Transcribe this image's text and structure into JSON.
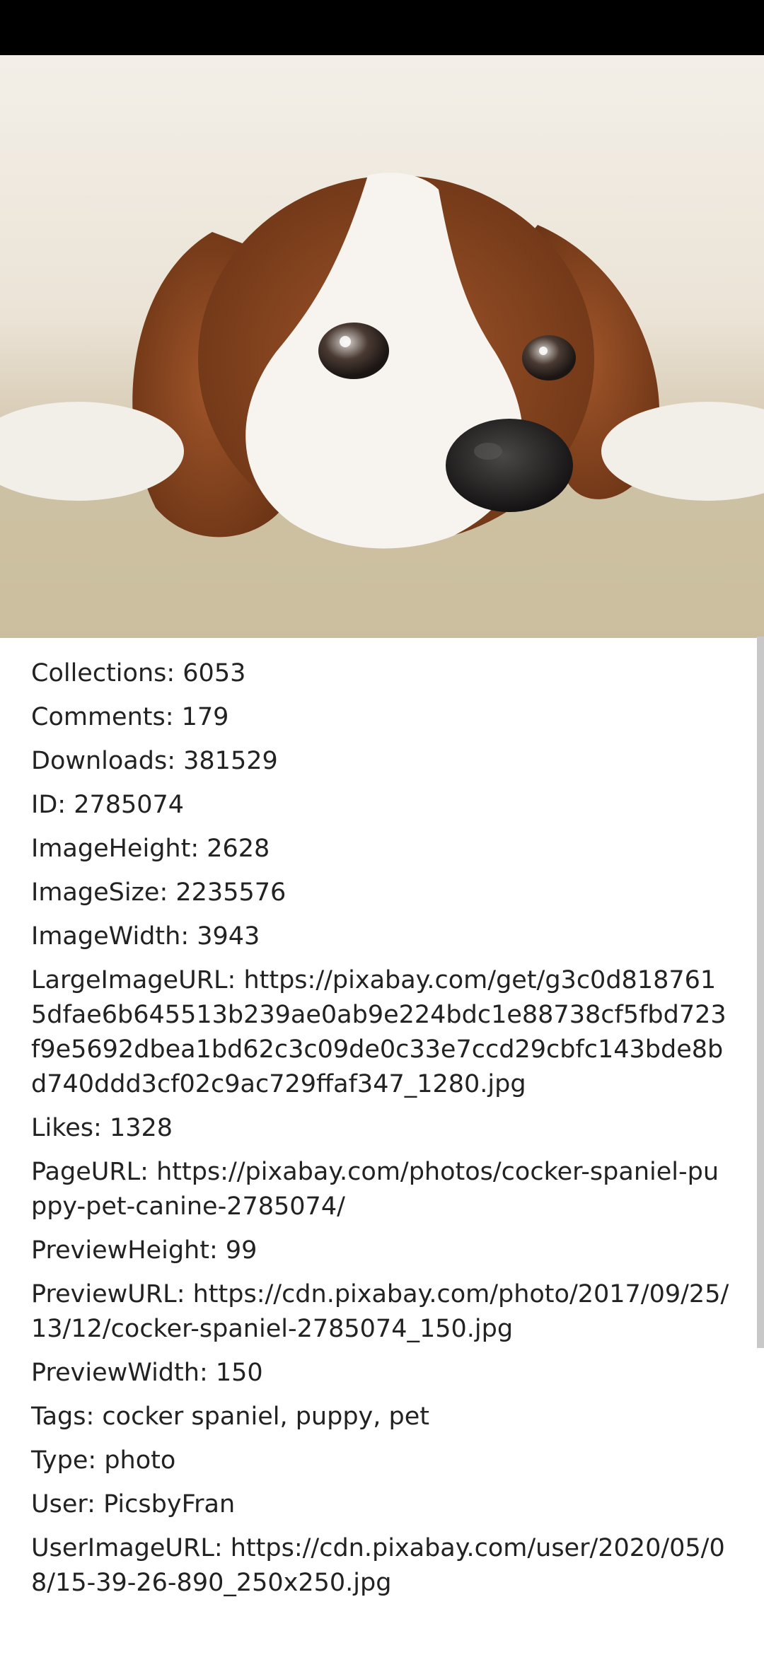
{
  "hero_image": {
    "icon": "dog-photo",
    "subject": "cocker spaniel puppy lying on carpet"
  },
  "details": [
    {
      "key": "Collections",
      "value": "6053"
    },
    {
      "key": "Comments",
      "value": "179"
    },
    {
      "key": "Downloads",
      "value": "381529"
    },
    {
      "key": "ID",
      "value": "2785074"
    },
    {
      "key": "ImageHeight",
      "value": "2628"
    },
    {
      "key": "ImageSize",
      "value": "2235576"
    },
    {
      "key": "ImageWidth",
      "value": "3943"
    },
    {
      "key": "LargeImageURL",
      "value": "https://pixabay.com/get/g3c0d8187615dfae6b645513b239ae0ab9e224bdc1e88738cf5fbd723f9e5692dbea1bd62c3c09de0c33e7ccd29cbfc143bde8bd740ddd3cf02c9ac729ffaf347_1280.jpg"
    },
    {
      "key": "Likes",
      "value": "1328"
    },
    {
      "key": "PageURL",
      "value": "https://pixabay.com/photos/cocker-spaniel-puppy-pet-canine-2785074/"
    },
    {
      "key": "PreviewHeight",
      "value": "99"
    },
    {
      "key": "PreviewURL",
      "value": "https://cdn.pixabay.com/photo/2017/09/25/13/12/cocker-spaniel-2785074_150.jpg"
    },
    {
      "key": "PreviewWidth",
      "value": "150"
    },
    {
      "key": "Tags",
      "value": "cocker spaniel, puppy, pet"
    },
    {
      "key": "Type",
      "value": "photo"
    },
    {
      "key": "User",
      "value": "PicsbyFran"
    },
    {
      "key": "UserImageURL",
      "value": "https://cdn.pixabay.com/user/2020/05/08/15-39-26-890_250x250.jpg"
    }
  ],
  "colors": {
    "status_bar": "#000000",
    "text": "#222222",
    "scrollbar": "#c8c8c8"
  }
}
